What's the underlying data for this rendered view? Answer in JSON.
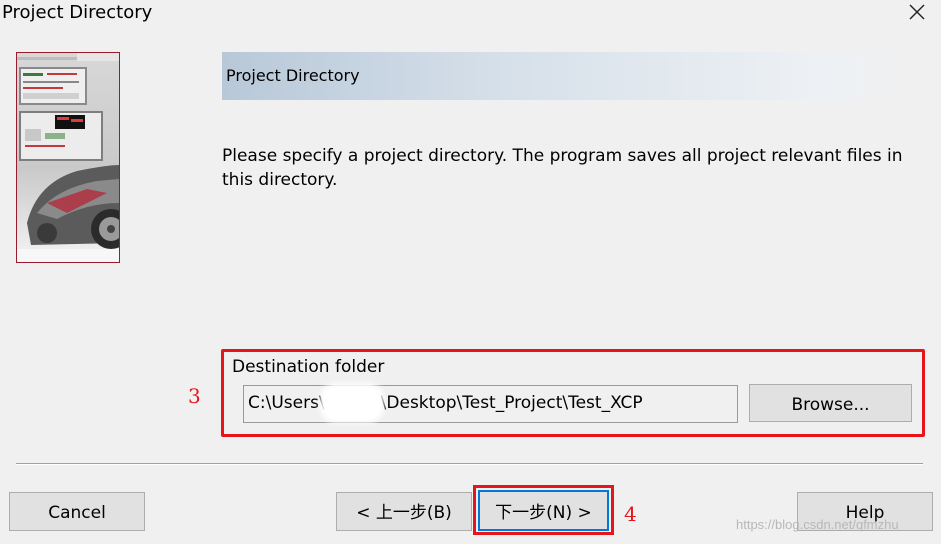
{
  "window": {
    "title": "Project Directory",
    "close_icon": "close-icon"
  },
  "header": {
    "title": "Project Directory"
  },
  "description": "Please specify a project directory. The program saves all project relevant files in this directory.",
  "destination": {
    "group_label": "Destination folder",
    "path_prefix": "C:\\Users\\",
    "path_suffix": "\\Desktop\\Test_Project\\Test_XCP",
    "browse_label": "Browse..."
  },
  "annotations": {
    "marker_3": "3",
    "marker_4": "4"
  },
  "buttons": {
    "cancel": "Cancel",
    "back": "< 上一步(B)",
    "next": "下一步(N) >",
    "help": "Help"
  },
  "watermark": "https://blog.csdn.net/qfmzhu",
  "colors": {
    "highlight_red": "#e8141c",
    "focus_blue": "#0078d7"
  }
}
